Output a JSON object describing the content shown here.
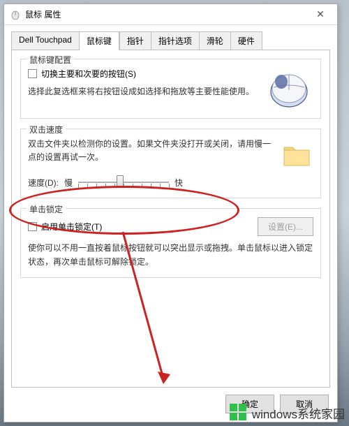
{
  "window": {
    "title": "鼠标 属性",
    "close_glyph": "✕"
  },
  "tabs": [
    {
      "label": "Dell Touchpad"
    },
    {
      "label": "鼠标键"
    },
    {
      "label": "指针"
    },
    {
      "label": "指针选项"
    },
    {
      "label": "滑轮"
    },
    {
      "label": "硬件"
    }
  ],
  "group_buttons": {
    "legend": "鼠标键配置",
    "checkbox_label": "切换主要和次要的按钮(S)",
    "desc": "选择此复选框来将右按钮设成如选择和拖放等主要性能使用。"
  },
  "group_speed": {
    "legend": "双击速度",
    "desc": "双击文件夹以检测你的设置。如果文件夹没打开或关闭，请用慢一点的设置再试一次。",
    "speed_label": "速度(D):",
    "slow": "慢",
    "fast": "快"
  },
  "group_lock": {
    "legend": "单击锁定",
    "checkbox_label": "启用单击锁定(T)",
    "settings_btn": "设置(E)...",
    "desc": "使你可以不用一直按着鼠标按钮就可以突出显示或拖拽。单击鼠标以进入锁定状态，再次单击鼠标可解除锁定。"
  },
  "buttons": {
    "ok": "确定",
    "cancel": "取消"
  },
  "watermark": "windows系统家园"
}
